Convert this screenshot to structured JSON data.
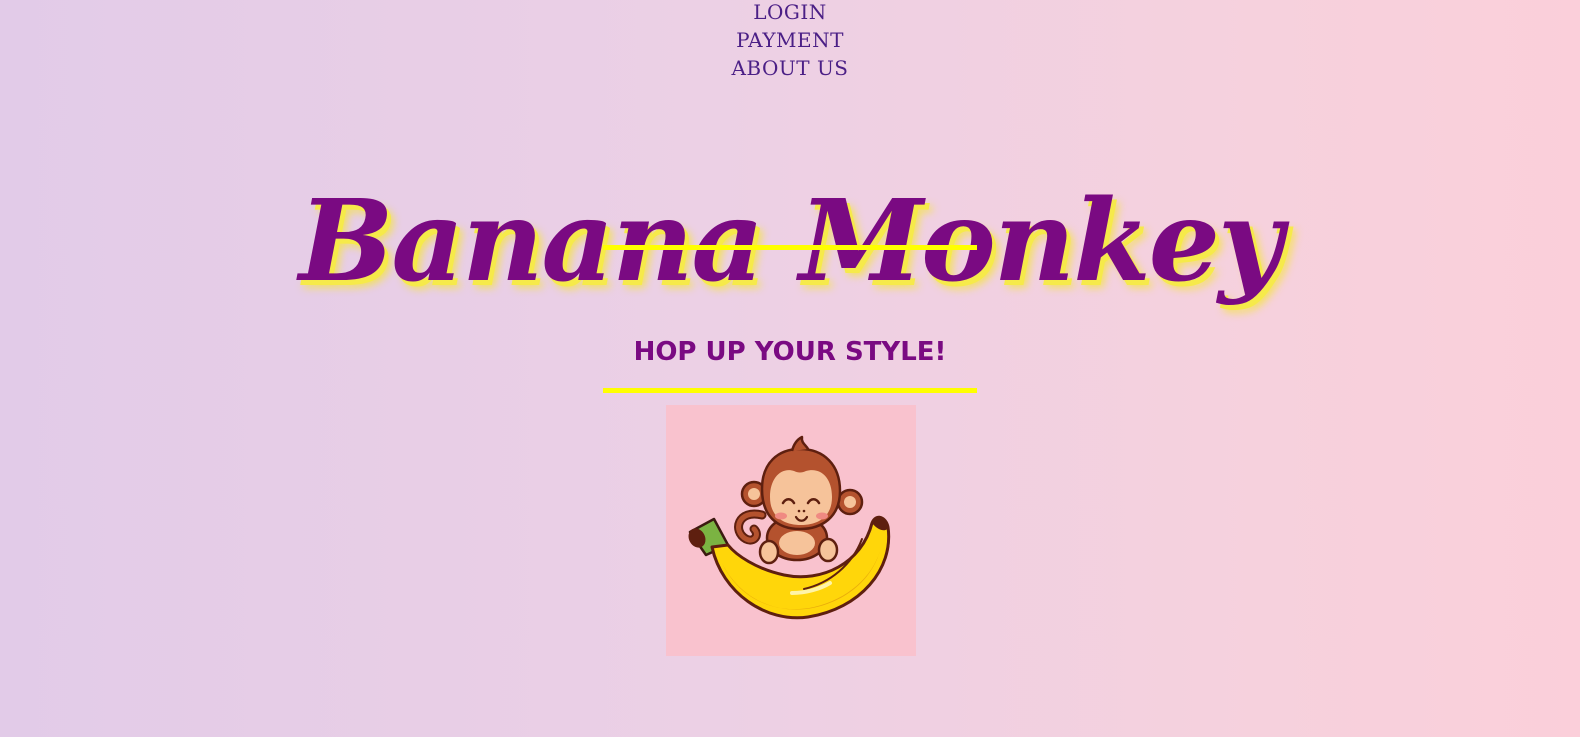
{
  "nav": {
    "items": [
      {
        "label": "LOGIN"
      },
      {
        "label": "PAYMENT"
      },
      {
        "label": "ABOUT US"
      }
    ]
  },
  "header": {
    "brand_title": "Banana Monkey"
  },
  "hero": {
    "tagline": "HOP UP YOUR STYLE!",
    "image_subject": "monkey-on-banana-illustration"
  },
  "colors": {
    "background_start": "#e2cbe8",
    "background_end": "#fbcfda",
    "brand_purple": "#7a0a82",
    "nav_purple": "#4b1f86",
    "accent_yellow": "#ffff00",
    "image_background": "#f9c2ce"
  }
}
